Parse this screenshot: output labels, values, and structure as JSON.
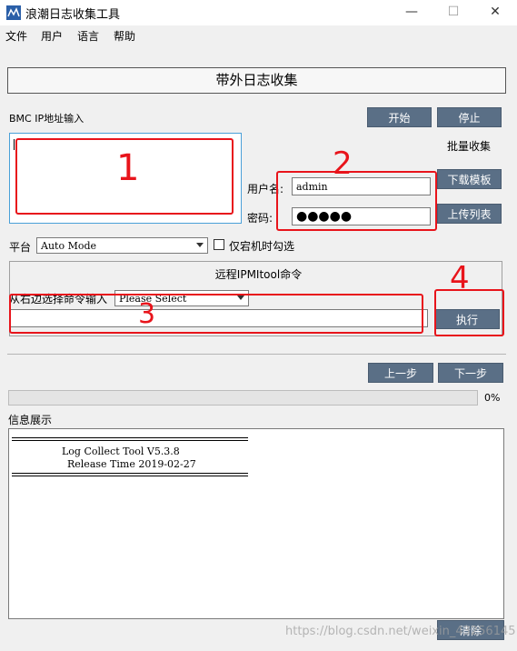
{
  "window": {
    "title": "浪潮日志收集工具",
    "minimize_glyph": "—",
    "maximize_glyph": "☐",
    "close_glyph": "✕"
  },
  "menu": [
    "文件",
    "用户",
    "语言",
    "帮助"
  ],
  "header_title": "带外日志收集",
  "bmc": {
    "label": "BMC IP地址输入"
  },
  "buttons": {
    "start": "开始",
    "stop": "停止",
    "batch": "批量收集",
    "download_template": "下载模板",
    "upload_list": "上传列表",
    "execute": "执行",
    "prev": "上一步",
    "next": "下一步",
    "clear": "清除"
  },
  "credentials": {
    "username_label": "用户名:",
    "username_value": "admin",
    "password_label": "密码:",
    "password_value": "●●●●●"
  },
  "platform": {
    "label": "平台",
    "selected": "Auto Mode",
    "checkbox_label": "仅宕机时勾选",
    "checked": false
  },
  "ipmi": {
    "section_title": "远程IPMItool命令",
    "hint": "从右边选择命令输入",
    "select_value": "Please Select",
    "command_value": ""
  },
  "progress": {
    "value": 0,
    "label": "0%"
  },
  "info": {
    "label": "信息展示",
    "lines": [
      "Log Collect Tool V5.3.8",
      "Release Time 2019-02-27"
    ]
  },
  "annotations": [
    "1",
    "2",
    "3",
    "4"
  ],
  "watermark": "https://blog.csdn.net/weixin_43256145",
  "colors": {
    "button": "#5a6f86",
    "annotation": "#e8141b",
    "selection_border": "#4aa0d8"
  }
}
